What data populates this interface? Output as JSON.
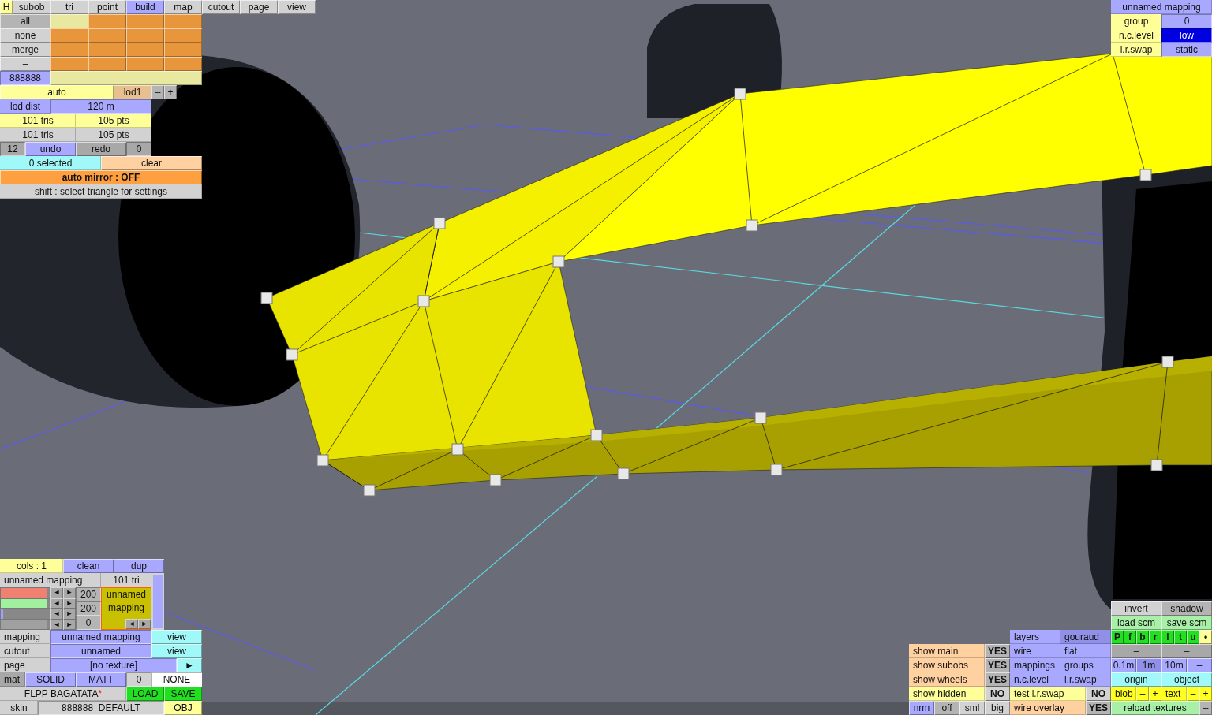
{
  "hide_button": {
    "text": "H",
    "color": "#ffff99"
  },
  "tabs": [
    {
      "label": "subob",
      "selected": false
    },
    {
      "label": "tri",
      "selected": false
    },
    {
      "label": "point",
      "selected": false
    },
    {
      "label": "build",
      "selected": true
    },
    {
      "label": "map",
      "selected": false
    },
    {
      "label": "cutout",
      "selected": false
    },
    {
      "label": "page",
      "selected": false
    },
    {
      "label": "view",
      "selected": false
    }
  ],
  "build_panel": {
    "select_rows": [
      [
        {
          "kind": "button",
          "text": "all",
          "color": "#b4b4b4"
        },
        {
          "kind": "swatch",
          "color": "#e8e8a0"
        },
        {
          "kind": "swatch",
          "color": "#e8963c"
        },
        {
          "kind": "swatch",
          "color": "#e8963c"
        },
        {
          "kind": "swatch",
          "color": "#e8963c"
        }
      ],
      [
        {
          "kind": "button",
          "text": "none",
          "color": "#d2d2d2"
        },
        {
          "kind": "swatch",
          "color": "#e8963c"
        },
        {
          "kind": "swatch",
          "color": "#e8963c"
        },
        {
          "kind": "swatch",
          "color": "#e8963c"
        },
        {
          "kind": "swatch",
          "color": "#e8963c"
        }
      ],
      [
        {
          "kind": "button",
          "text": "merge",
          "color": "#d2d2d2"
        },
        {
          "kind": "swatch",
          "color": "#e8963c"
        },
        {
          "kind": "swatch",
          "color": "#e8963c"
        },
        {
          "kind": "swatch",
          "color": "#e8963c"
        },
        {
          "kind": "swatch",
          "color": "#e8963c"
        }
      ],
      [
        {
          "kind": "button",
          "text": "–",
          "color": "#d2d2d2"
        },
        {
          "kind": "swatch",
          "color": "#e8963c"
        },
        {
          "kind": "swatch",
          "color": "#e8963c"
        },
        {
          "kind": "swatch",
          "color": "#e8963c"
        },
        {
          "kind": "swatch",
          "color": "#e8963c"
        }
      ]
    ],
    "color_row": [
      {
        "kind": "value",
        "text": "888888",
        "color": "#a8a8ff"
      },
      {
        "kind": "swatch",
        "color": "#e8e8a0"
      }
    ],
    "lod_row": [
      {
        "kind": "button",
        "text": "auto",
        "color": "#ffff99"
      },
      {
        "kind": "button",
        "text": "lod1",
        "color": "#e8c090"
      },
      {
        "kind": "button",
        "text": "–",
        "color": "#b4b4b4"
      },
      {
        "kind": "button",
        "text": "+",
        "color": "#b4b4b4"
      }
    ],
    "lod_distance_row": [
      {
        "kind": "caption",
        "text": "lod dist",
        "color": "#a8a8ff"
      },
      {
        "kind": "value",
        "text": "120 m",
        "color": "#a8a8ff"
      }
    ],
    "count_rows": [
      [
        {
          "kind": "caption",
          "text": "101 tris",
          "color": "#ffff99"
        },
        {
          "kind": "caption",
          "text": "105 pts",
          "color": "#ffff99"
        }
      ],
      [
        {
          "kind": "caption",
          "text": "101 tris",
          "color": "#d2d2d2"
        },
        {
          "kind": "caption",
          "text": "105 pts",
          "color": "#d2d2d2"
        }
      ]
    ],
    "history_row": [
      {
        "kind": "value",
        "text": "12",
        "color": "#a8a8a8"
      },
      {
        "kind": "button",
        "text": "undo",
        "color": "#a8a8ff"
      },
      {
        "kind": "button",
        "text": "redo",
        "color": "#a8a8a8"
      },
      {
        "kind": "value",
        "text": "0",
        "color": "#a8a8a8"
      }
    ],
    "selection_row": [
      {
        "kind": "caption",
        "text": "0 selected",
        "color": "#a0f8f8"
      },
      {
        "kind": "button",
        "text": "clear",
        "color": "#ffd0a0"
      }
    ],
    "mirror_row": [
      {
        "kind": "toggle",
        "text": "auto mirror : OFF",
        "color": "#ffa040"
      }
    ],
    "hint_row": [
      {
        "kind": "caption",
        "text": "shift : select triangle for settings",
        "color": "#d2d2d2"
      }
    ]
  },
  "mapping_panel": {
    "title_row": [
      {
        "kind": "caption",
        "text": "unnamed mapping",
        "color": "#a8a8ff"
      }
    ],
    "setting_rows": [
      [
        {
          "kind": "caption",
          "text": "group",
          "color": "#ffff99"
        },
        {
          "kind": "value",
          "text": "0",
          "color": "#a8a8ff"
        }
      ],
      [
        {
          "kind": "caption",
          "text": "n.c.level",
          "color": "#ffff99"
        },
        {
          "kind": "value",
          "text": "low",
          "color": "#0000e0"
        }
      ],
      [
        {
          "kind": "caption",
          "text": "l.r.swap",
          "color": "#ffff99"
        },
        {
          "kind": "value",
          "text": "static",
          "color": "#a8a8ff"
        }
      ]
    ]
  },
  "material_panel": {
    "top_row": [
      {
        "kind": "caption",
        "text": "cols : 1",
        "color": "#ffff99"
      },
      {
        "kind": "button",
        "text": "clean",
        "color": "#a8a8ff"
      },
      {
        "kind": "button",
        "text": "dup",
        "color": "#a8a8ff"
      }
    ],
    "name_row": [
      {
        "kind": "label",
        "text": "unnamed mapping",
        "color": "#d2d2d2"
      },
      {
        "kind": "caption",
        "text": "101 tri",
        "color": "#d2d2d2"
      }
    ],
    "sliders": [
      {
        "color": "#f08070",
        "level": 0.95
      },
      {
        "color": "#a0f0a0",
        "level": 0.95
      },
      {
        "color": "#a0a0ff",
        "level": 0.05
      },
      {
        "color": "#a0a0a0",
        "level": 0.95
      }
    ],
    "arrows": [
      [
        "◄",
        "►"
      ],
      [
        "◄",
        "►"
      ],
      [
        "◄",
        "►"
      ],
      [
        "◄",
        "►"
      ]
    ],
    "values": [
      "200",
      "200",
      "0"
    ],
    "preview": {
      "text": "unnamed mapping",
      "color": "#c8c000",
      "arrows": [
        "◄",
        "►"
      ]
    },
    "mapping_rows": [
      [
        {
          "kind": "label",
          "text": "mapping",
          "color": "#d2d2d2"
        },
        {
          "kind": "value",
          "text": "unnamed mapping",
          "color": "#a8a8ff"
        },
        {
          "kind": "button",
          "text": "view",
          "color": "#a0f8f8"
        }
      ],
      [
        {
          "kind": "label",
          "text": "cutout",
          "color": "#d2d2d2"
        },
        {
          "kind": "value",
          "text": "unnamed",
          "color": "#a8a8ff"
        },
        {
          "kind": "button",
          "text": "view",
          "color": "#a0f8f8"
        }
      ]
    ],
    "page_row": [
      {
        "kind": "label",
        "text": "page",
        "color": "#d2d2d2"
      },
      {
        "kind": "value",
        "text": "[no texture]",
        "color": "#a8a8ff"
      },
      {
        "kind": "button",
        "text": "►",
        "color": "#a0f8f8"
      }
    ],
    "material_row": [
      {
        "kind": "label",
        "text": "mat",
        "color": "#a8a8a8"
      },
      {
        "kind": "button",
        "text": "SOLID",
        "color": "#a8a8ff"
      },
      {
        "kind": "button",
        "text": "MATT",
        "color": "#a8a8ff"
      },
      {
        "kind": "value",
        "text": "0",
        "color": "#d2d2d2"
      },
      {
        "kind": "value",
        "text": "NONE",
        "color": "#ffffff"
      }
    ],
    "file_row": [
      {
        "kind": "caption",
        "text": "FLPP BAGATATA",
        "suffix": "*",
        "color": "#d2d2d2"
      },
      {
        "kind": "button",
        "text": "LOAD",
        "color": "#20e020"
      },
      {
        "kind": "button",
        "text": "SAVE",
        "color": "#20e020"
      }
    ],
    "skin_row": [
      {
        "kind": "caption",
        "text": "skin",
        "color": "#d2d2d2"
      },
      {
        "kind": "value",
        "text": "888888_DEFAULT",
        "color": "#d2d2d2"
      },
      {
        "kind": "button",
        "text": "OBJ",
        "color": "#ffff99"
      }
    ]
  },
  "view_panel": {
    "scene_rows": [
      [
        {
          "kind": "button",
          "text": "invert",
          "color": "#d2d2d2"
        },
        {
          "kind": "button",
          "text": "shadow",
          "color": "#b4b4b4"
        }
      ],
      [
        {
          "kind": "button",
          "text": "load scm",
          "color": "#a8f0a8"
        },
        {
          "kind": "button",
          "text": "save scm",
          "color": "#a8f0a8"
        }
      ]
    ],
    "render_row": [
      {
        "kind": "label",
        "text": "layers",
        "color": "#a8a8ff"
      },
      {
        "kind": "label",
        "text": "gouraud",
        "color": "#9090e8"
      },
      {
        "kind": "toggle",
        "text": "P",
        "color": "#20e020"
      },
      {
        "kind": "toggle",
        "text": "f",
        "color": "#20e020"
      },
      {
        "kind": "toggle",
        "text": "b",
        "color": "#20e020"
      },
      {
        "kind": "toggle",
        "text": "r",
        "color": "#20e020"
      },
      {
        "kind": "toggle",
        "text": "l",
        "color": "#20e020"
      },
      {
        "kind": "toggle",
        "text": "t",
        "color": "#20e020"
      },
      {
        "kind": "toggle",
        "text": "u",
        "color": "#20e020"
      },
      {
        "kind": "toggle",
        "text": "•",
        "color": "#ffff99"
      }
    ],
    "main_row": [
      {
        "kind": "label",
        "text": "show main",
        "color": "#ffd0a0"
      },
      {
        "kind": "toggle",
        "text": "YES",
        "color": "#b4b4b4"
      },
      {
        "kind": "label",
        "text": "wire",
        "color": "#a8a8ff"
      },
      {
        "kind": "label",
        "text": "flat",
        "color": "#a8a8ff"
      },
      {
        "kind": "button",
        "text": "–",
        "color": "#a8a8a8"
      },
      {
        "kind": "button",
        "text": "–",
        "color": "#a8a8a8"
      }
    ],
    "subobs_row": [
      {
        "kind": "label",
        "text": "show subobs",
        "color": "#ffd0a0"
      },
      {
        "kind": "toggle",
        "text": "YES",
        "color": "#b4b4b4"
      },
      {
        "kind": "label",
        "text": "mappings",
        "color": "#a8a8ff"
      },
      {
        "kind": "label",
        "text": "groups",
        "color": "#a8a8ff"
      },
      {
        "kind": "button",
        "text": "0.1m",
        "color": "#a8a8ff"
      },
      {
        "kind": "button",
        "text": "1m",
        "color": "#9090e8"
      },
      {
        "kind": "button",
        "text": "10m",
        "color": "#a8a8ff"
      },
      {
        "kind": "button",
        "text": "–",
        "color": "#a8a8ff"
      }
    ],
    "wheels_row": [
      {
        "kind": "label",
        "text": "show wheels",
        "color": "#ffd0a0"
      },
      {
        "kind": "toggle",
        "text": "YES",
        "color": "#b4b4b4"
      },
      {
        "kind": "label",
        "text": "n.c.level",
        "color": "#a8a8ff"
      },
      {
        "kind": "label",
        "text": "l.r.swap",
        "color": "#a8a8ff"
      },
      {
        "kind": "button",
        "text": "origin",
        "color": "#a0f8f8"
      },
      {
        "kind": "button",
        "text": "object",
        "color": "#a0f8f8"
      }
    ],
    "hidden_row": [
      {
        "kind": "label",
        "text": "show hidden",
        "color": "#ffff99"
      },
      {
        "kind": "toggle",
        "text": "NO",
        "color": "#d2d2d2"
      },
      {
        "kind": "label",
        "text": "test l.r.swap",
        "color": "#ffff99"
      },
      {
        "kind": "toggle",
        "text": "NO",
        "color": "#d2d2d2"
      },
      {
        "kind": "label",
        "text": "blob",
        "color": "#ffff20"
      },
      {
        "kind": "button",
        "text": "–",
        "color": "#ffff20"
      },
      {
        "kind": "button",
        "text": "+",
        "color": "#ffff20"
      },
      {
        "kind": "label",
        "text": "text",
        "color": "#ffff20"
      },
      {
        "kind": "button",
        "text": "–",
        "color": "#ffff20"
      },
      {
        "kind": "button",
        "text": "+",
        "color": "#ffff20"
      }
    ],
    "display_row": [
      {
        "kind": "button",
        "text": "nrm",
        "color": "#a8a8ff"
      },
      {
        "kind": "button",
        "text": "off",
        "color": "#b4b4b4"
      },
      {
        "kind": "button",
        "text": "sml",
        "color": "#d2d2d2"
      },
      {
        "kind": "button",
        "text": "big",
        "color": "#d2d2d2"
      },
      {
        "kind": "label",
        "text": "wire overlay",
        "color": "#ffd0a0"
      },
      {
        "kind": "toggle",
        "text": "YES",
        "color": "#b4b4b4"
      },
      {
        "kind": "button",
        "text": "reload textures",
        "color": "#a8f0a8"
      },
      {
        "kind": "button",
        "text": "–",
        "color": "#b4b4b4"
      }
    ]
  }
}
